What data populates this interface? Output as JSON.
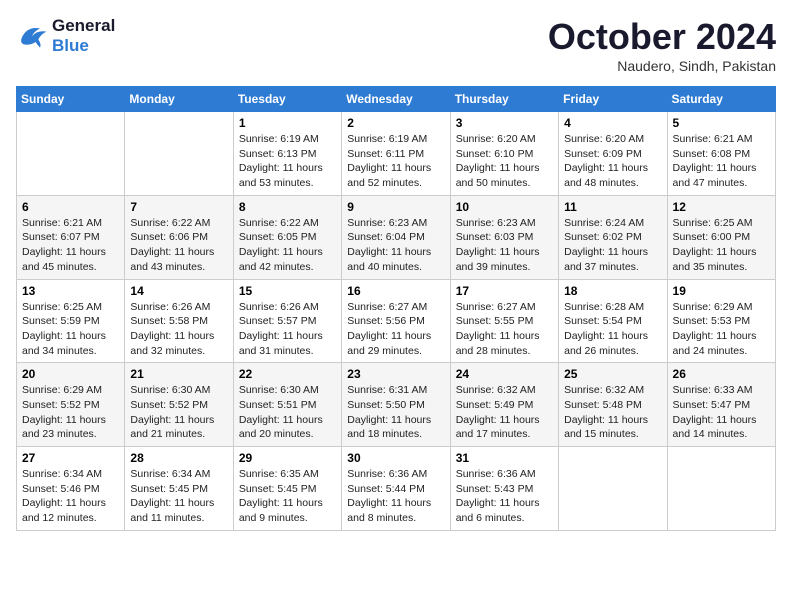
{
  "header": {
    "logo_line1": "General",
    "logo_line2": "Blue",
    "month_title": "October 2024",
    "subtitle": "Naudero, Sindh, Pakistan"
  },
  "days_of_week": [
    "Sunday",
    "Monday",
    "Tuesday",
    "Wednesday",
    "Thursday",
    "Friday",
    "Saturday"
  ],
  "weeks": [
    [
      {
        "day": "",
        "info": ""
      },
      {
        "day": "",
        "info": ""
      },
      {
        "day": "1",
        "info": "Sunrise: 6:19 AM\nSunset: 6:13 PM\nDaylight: 11 hours and 53 minutes."
      },
      {
        "day": "2",
        "info": "Sunrise: 6:19 AM\nSunset: 6:11 PM\nDaylight: 11 hours and 52 minutes."
      },
      {
        "day": "3",
        "info": "Sunrise: 6:20 AM\nSunset: 6:10 PM\nDaylight: 11 hours and 50 minutes."
      },
      {
        "day": "4",
        "info": "Sunrise: 6:20 AM\nSunset: 6:09 PM\nDaylight: 11 hours and 48 minutes."
      },
      {
        "day": "5",
        "info": "Sunrise: 6:21 AM\nSunset: 6:08 PM\nDaylight: 11 hours and 47 minutes."
      }
    ],
    [
      {
        "day": "6",
        "info": "Sunrise: 6:21 AM\nSunset: 6:07 PM\nDaylight: 11 hours and 45 minutes."
      },
      {
        "day": "7",
        "info": "Sunrise: 6:22 AM\nSunset: 6:06 PM\nDaylight: 11 hours and 43 minutes."
      },
      {
        "day": "8",
        "info": "Sunrise: 6:22 AM\nSunset: 6:05 PM\nDaylight: 11 hours and 42 minutes."
      },
      {
        "day": "9",
        "info": "Sunrise: 6:23 AM\nSunset: 6:04 PM\nDaylight: 11 hours and 40 minutes."
      },
      {
        "day": "10",
        "info": "Sunrise: 6:23 AM\nSunset: 6:03 PM\nDaylight: 11 hours and 39 minutes."
      },
      {
        "day": "11",
        "info": "Sunrise: 6:24 AM\nSunset: 6:02 PM\nDaylight: 11 hours and 37 minutes."
      },
      {
        "day": "12",
        "info": "Sunrise: 6:25 AM\nSunset: 6:00 PM\nDaylight: 11 hours and 35 minutes."
      }
    ],
    [
      {
        "day": "13",
        "info": "Sunrise: 6:25 AM\nSunset: 5:59 PM\nDaylight: 11 hours and 34 minutes."
      },
      {
        "day": "14",
        "info": "Sunrise: 6:26 AM\nSunset: 5:58 PM\nDaylight: 11 hours and 32 minutes."
      },
      {
        "day": "15",
        "info": "Sunrise: 6:26 AM\nSunset: 5:57 PM\nDaylight: 11 hours and 31 minutes."
      },
      {
        "day": "16",
        "info": "Sunrise: 6:27 AM\nSunset: 5:56 PM\nDaylight: 11 hours and 29 minutes."
      },
      {
        "day": "17",
        "info": "Sunrise: 6:27 AM\nSunset: 5:55 PM\nDaylight: 11 hours and 28 minutes."
      },
      {
        "day": "18",
        "info": "Sunrise: 6:28 AM\nSunset: 5:54 PM\nDaylight: 11 hours and 26 minutes."
      },
      {
        "day": "19",
        "info": "Sunrise: 6:29 AM\nSunset: 5:53 PM\nDaylight: 11 hours and 24 minutes."
      }
    ],
    [
      {
        "day": "20",
        "info": "Sunrise: 6:29 AM\nSunset: 5:52 PM\nDaylight: 11 hours and 23 minutes."
      },
      {
        "day": "21",
        "info": "Sunrise: 6:30 AM\nSunset: 5:52 PM\nDaylight: 11 hours and 21 minutes."
      },
      {
        "day": "22",
        "info": "Sunrise: 6:30 AM\nSunset: 5:51 PM\nDaylight: 11 hours and 20 minutes."
      },
      {
        "day": "23",
        "info": "Sunrise: 6:31 AM\nSunset: 5:50 PM\nDaylight: 11 hours and 18 minutes."
      },
      {
        "day": "24",
        "info": "Sunrise: 6:32 AM\nSunset: 5:49 PM\nDaylight: 11 hours and 17 minutes."
      },
      {
        "day": "25",
        "info": "Sunrise: 6:32 AM\nSunset: 5:48 PM\nDaylight: 11 hours and 15 minutes."
      },
      {
        "day": "26",
        "info": "Sunrise: 6:33 AM\nSunset: 5:47 PM\nDaylight: 11 hours and 14 minutes."
      }
    ],
    [
      {
        "day": "27",
        "info": "Sunrise: 6:34 AM\nSunset: 5:46 PM\nDaylight: 11 hours and 12 minutes."
      },
      {
        "day": "28",
        "info": "Sunrise: 6:34 AM\nSunset: 5:45 PM\nDaylight: 11 hours and 11 minutes."
      },
      {
        "day": "29",
        "info": "Sunrise: 6:35 AM\nSunset: 5:45 PM\nDaylight: 11 hours and 9 minutes."
      },
      {
        "day": "30",
        "info": "Sunrise: 6:36 AM\nSunset: 5:44 PM\nDaylight: 11 hours and 8 minutes."
      },
      {
        "day": "31",
        "info": "Sunrise: 6:36 AM\nSunset: 5:43 PM\nDaylight: 11 hours and 6 minutes."
      },
      {
        "day": "",
        "info": ""
      },
      {
        "day": "",
        "info": ""
      }
    ]
  ]
}
